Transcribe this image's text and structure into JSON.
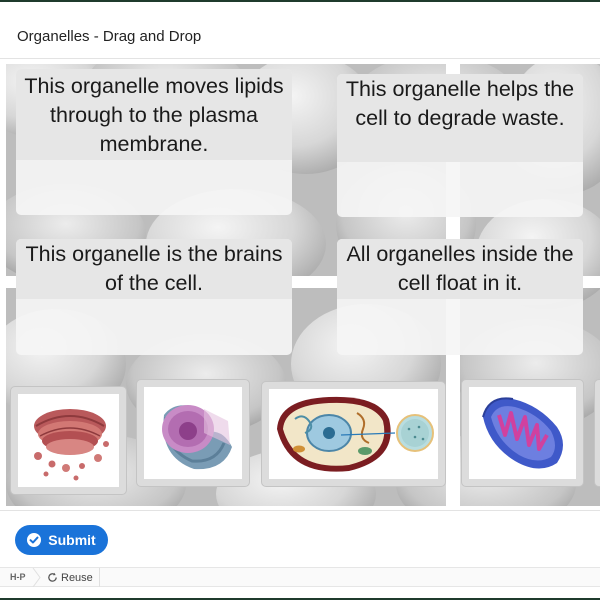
{
  "title": "Organelles - Drag and Drop",
  "dropzones": [
    {
      "label": "This organelle moves lipids through to the plasma membrane."
    },
    {
      "label": "This organelle helps the cell to degrade waste."
    },
    {
      "label": "This organelle is the brains of the cell."
    },
    {
      "label": "All organelles inside the cell float in it."
    }
  ],
  "draggables": [
    {
      "icon": "golgi-apparatus-icon"
    },
    {
      "icon": "nucleus-icon"
    },
    {
      "icon": "cell-diagram-icon"
    },
    {
      "icon": "mitochondrion-icon"
    }
  ],
  "actions": {
    "submit_label": "Submit"
  },
  "footer": {
    "logo_text": "H-P",
    "reuse_label": "Reuse"
  },
  "colors": {
    "accent": "#1a73d9",
    "border_dark": "#1f3b2d"
  }
}
